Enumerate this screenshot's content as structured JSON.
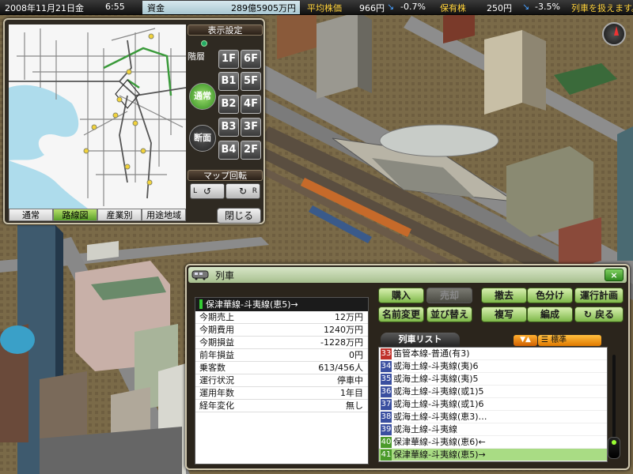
{
  "status_bar": {
    "date": "2008年11月21日金",
    "time": "6:55",
    "fund_label": "資金",
    "fund_value": "289億5905万円",
    "stock_label": "平均株価",
    "stock_value": "966円",
    "stock_arrow": "↘",
    "stock_change": "-0.7%",
    "hold_label": "保有株",
    "hold_value": "250円",
    "hold_arrow": "↘",
    "hold_change": "-3.5%",
    "ticker": "列車を扱えます。"
  },
  "map_panel": {
    "display_settings": "表示設定",
    "floor_label": "階層",
    "mode_normal": "通常",
    "mode_section": "断面",
    "floors": [
      "1F",
      "6F",
      "B1",
      "5F",
      "B2",
      "4F",
      "B3",
      "3F",
      "B4",
      "2F"
    ],
    "rotate_label": "マップ回転",
    "rotate_left": "L",
    "rotate_right": "R",
    "close_label": "閉じる",
    "tabs": [
      "通常",
      "路線図",
      "産業別",
      "用途地域"
    ],
    "active_tab": "路線図"
  },
  "train_window": {
    "title": "列車",
    "close_label": "×",
    "selected_train": "保津華線-斗夷線(恵5)→",
    "stats": [
      {
        "key": "今期売上",
        "value": "12万円"
      },
      {
        "key": "今期費用",
        "value": "1240万円"
      },
      {
        "key": "今期損益",
        "value": "-1228万円"
      },
      {
        "key": "前年損益",
        "value": "0円"
      },
      {
        "key": "乗客数",
        "value": "613/456人"
      },
      {
        "key": "運行状況",
        "value": "停車中"
      },
      {
        "key": "運用年数",
        "value": "1年目"
      },
      {
        "key": "経年変化",
        "value": "無し"
      }
    ],
    "buttons": {
      "buy": "購入",
      "sell": "売却",
      "remove": "撤去",
      "color": "色分け",
      "schedule": "運行計画",
      "rename": "名前変更",
      "sort": "並び替え",
      "copy": "複写",
      "formation": "編成",
      "back": "戻る"
    },
    "list_title": "列車リスト",
    "sort_toggle": "▼▲",
    "sort_mode": "標準",
    "trains": [
      {
        "num": "33",
        "name": "笛管本線-普通(有3)",
        "badge": "red"
      },
      {
        "num": "34",
        "name": "或海土線-斗夷線(夷)6",
        "badge": "blue"
      },
      {
        "num": "35",
        "name": "或海土線-斗夷線(夷)5",
        "badge": "blue"
      },
      {
        "num": "36",
        "name": "或海土線-斗夷線(或1)5",
        "badge": "blue"
      },
      {
        "num": "37",
        "name": "或海土線-斗夷線(或1)6",
        "badge": "blue"
      },
      {
        "num": "38",
        "name": "或海土線-斗夷線(恵3)…",
        "badge": "blue"
      },
      {
        "num": "39",
        "name": "或海土線-斗夷線",
        "badge": "blue"
      },
      {
        "num": "40",
        "name": "保津華線-斗夷線(恵6)←",
        "badge": "green"
      },
      {
        "num": "41",
        "name": "保津華線-斗夷線(恵5)→",
        "badge": "green",
        "selected": true
      }
    ]
  }
}
